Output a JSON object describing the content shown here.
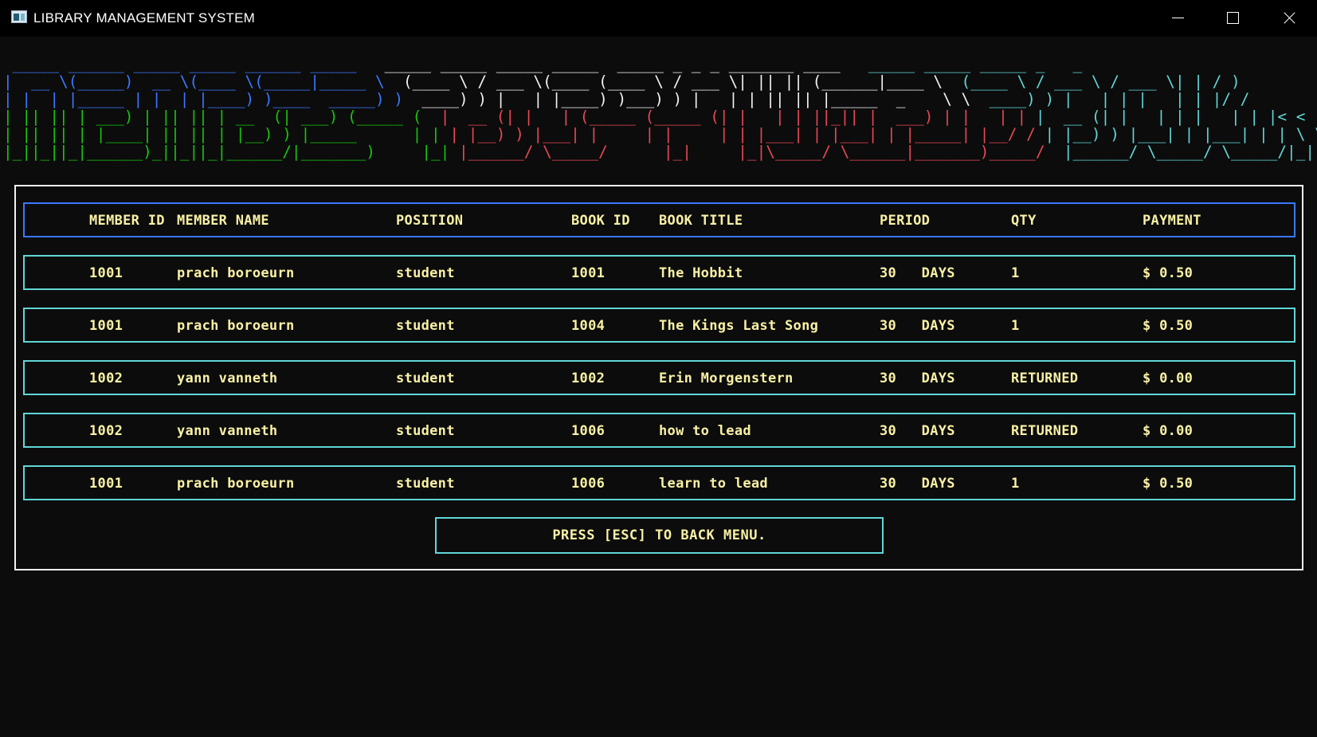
{
  "window": {
    "title": "LIBRARY MANAGEMENT SYSTEM"
  },
  "banner_lines": [
    {
      "b": " _____ ______ _____ _____ ______ _____",
      "w": "   _____ _____ _____ _____  _____ _ _ _ _______ ____",
      "c": "   _____ _____ _____ _   _"
    },
    {
      "b": "|  __ \\(_____)  __ \\(____ \\(_____|_____ \\",
      "w": "  (____ \\ / ___ \\(____ (____ \\ / ___ \\| || || (______|____ \\",
      "c": "  (____ \\ / ___ \\ / ___ \\| | / )"
    },
    {
      "b": "| |  | |_____ | |  | |____) )____  _____) )",
      "w": "  ____) ) |   | |____) )___) ) |   | | || || |_____  _    \\ \\",
      "c": "  ____) ) |   | | |   | | |/ /"
    },
    {
      "g": "| || || | ___) | || || | __  (| ___) (_____ (",
      "r": "  |  __ (| |   | (_____ (_____ (| |   | | ||_|| |  ___) | |   | |",
      "c": " |  __ (| |   | | |   | | |< <"
    },
    {
      "g": "| || || | |____| || || | |__) ) |_____      | |",
      "r": " | |__) ) |___| |     | |     | | |___| | |___| | |_____| |__/ /",
      "c": " | |__) ) |___| | |___| | | \\ \\"
    },
    {
      "g": "|_||_||_|______)_||_||_|______/|_______)     |_|",
      "r": " |______/ \\_____/      |_|     |_|\\_____/ \\______|_______)_____/",
      "c": "  |______/ \\_____/ \\_____/|_|  \\_)"
    }
  ],
  "table": {
    "headers": [
      "MEMBER ID",
      "MEMBER NAME",
      "POSITION",
      "BOOK ID",
      "BOOK TITLE",
      "PERIOD",
      "QTY",
      "PAYMENT"
    ],
    "rows": [
      [
        "1001",
        "prach boroeurn",
        "student",
        "1001",
        "The Hobbit",
        "30   DAYS",
        "1",
        "$ 0.50"
      ],
      [
        "1001",
        "prach boroeurn",
        "student",
        "1004",
        "The Kings Last Song",
        "30   DAYS",
        "1",
        "$ 0.50"
      ],
      [
        "1002",
        "yann vanneth",
        "student",
        "1002",
        "Erin Morgenstern",
        "30   DAYS",
        "RETURNED",
        "$ 0.00"
      ],
      [
        "1002",
        "yann vanneth",
        "student",
        "1006",
        "how to lead",
        "30   DAYS",
        "RETURNED",
        "$ 0.00"
      ],
      [
        "1001",
        "prach boroeurn",
        "student",
        "1006",
        "learn to lead",
        "30   DAYS",
        "1",
        "$ 0.50"
      ]
    ]
  },
  "footer": {
    "esc_text": "PRESS [ESC] TO BACK MENU."
  },
  "colors": {
    "background": "#0c0c0c",
    "text_yellow": "#f9f1a5",
    "border_cyan": "#61d6d6",
    "border_blue": "#3b78ff",
    "banner_blue": "#3b78ff",
    "banner_green": "#16c60c",
    "banner_white": "#f2f2f2",
    "banner_red": "#e74856",
    "banner_cyan": "#61d6d6"
  }
}
